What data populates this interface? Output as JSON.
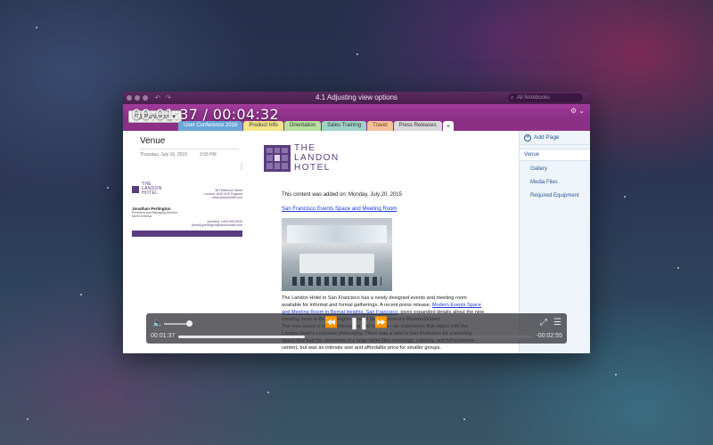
{
  "window": {
    "title": "4.1 Adjusting view options",
    "search_placeholder": "All Notebooks"
  },
  "notebook": {
    "label": "Business"
  },
  "tabs": [
    {
      "label": "User Conference 2016",
      "active": true
    },
    {
      "label": "Product Info"
    },
    {
      "label": "Orientation"
    },
    {
      "label": "Sales Training"
    },
    {
      "label": "Travel"
    },
    {
      "label": "Press Releases"
    },
    {
      "label": "+"
    }
  ],
  "page": {
    "title": "Venue",
    "date": "Thursday, July 16, 2015",
    "time": "3:03 PM"
  },
  "card": {
    "logo_line1": "THE",
    "logo_line2": "LANDON",
    "logo_line3": "HOTEL",
    "addr1": "567 Bellevue Street",
    "addr2": "London, W1D 4HZ England",
    "addr3": "www.landonhotel.com",
    "name": "Jonathan Perlington",
    "role1": "President and Managing Director",
    "role2": "North America",
    "contact1": "(contact) 1-000-000-0000",
    "contact2": "(email) jperlington@landonhotel.com"
  },
  "hotel_logo": {
    "line1": "THE",
    "line2": "LANDON",
    "line3": "HOTEL"
  },
  "content": {
    "added": "This content was added on: Monday, July 20, 2015",
    "link": "San Francisco Events Space and Meeting Room",
    "p1": "The Landon Hotel in San Francisco has a newly designed events and meeting room available for informal and formal gatherings. A recent press release,",
    "p1_link": "Modern Events Space and Meeting Room in Bernal Heights, San Francisco",
    "p1_rest": ", gives expanded details about the new meeting room in Bernal Heights, one of San Francisco's Mission District.",
    "p2": "The new space is chic, professional and intimate—an experience that aligns with the Landon Hotel's corporate philosophy. There was a void in San Francisco for a meeting space that had the amenities of a large hotel (like concierge, catering, and full business center), but was an intimate size and affordable price for smaller groups."
  },
  "sidebar": {
    "add_page": "Add Page",
    "pages": [
      {
        "label": "Venue",
        "active": true
      },
      {
        "label": "Gallery"
      },
      {
        "label": "Media Files"
      },
      {
        "label": "Required Equipment"
      }
    ]
  },
  "player": {
    "overlay_time": "00:01:37 / 00:04:32",
    "elapsed": "00:01:37",
    "remaining": "-00:02:55",
    "progress_percent": 35.7,
    "volume_percent": 90
  },
  "icons": {
    "volume": "speaker-icon",
    "rewind": "rewind-icon",
    "play": "pause-icon",
    "forward": "fast-forward-icon",
    "fullscreen": "fullscreen-icon",
    "playlist": "list-icon"
  }
}
